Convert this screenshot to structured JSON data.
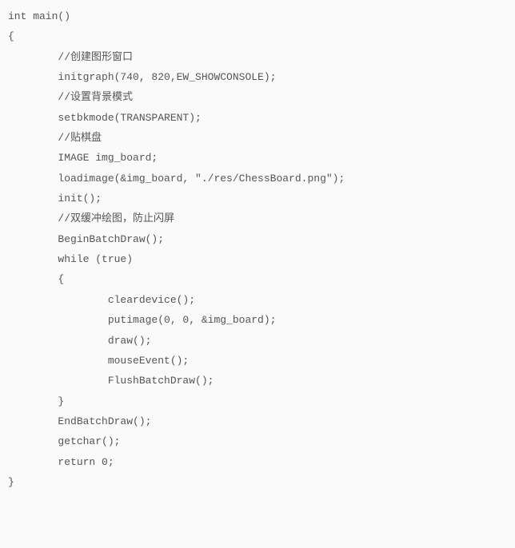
{
  "code": {
    "lines": [
      "int main()",
      "{",
      "        //创建图形窗口",
      "        initgraph(740, 820,EW_SHOWCONSOLE);",
      "        //设置背景模式",
      "        setbkmode(TRANSPARENT);",
      "        //贴棋盘",
      "        IMAGE img_board;",
      "        loadimage(&img_board, \"./res/ChessBoard.png\");",
      "",
      "",
      "        init();",
      "        //双缓冲绘图，防止闪屏",
      "        BeginBatchDraw();",
      "        while (true)",
      "        {",
      "                cleardevice();",
      "                putimage(0, 0, &img_board);",
      "                draw();",
      "                mouseEvent();",
      "",
      "                FlushBatchDraw();",
      "        }",
      "        EndBatchDraw();",
      "",
      "",
      "        getchar();",
      "        return 0;",
      "}"
    ]
  }
}
